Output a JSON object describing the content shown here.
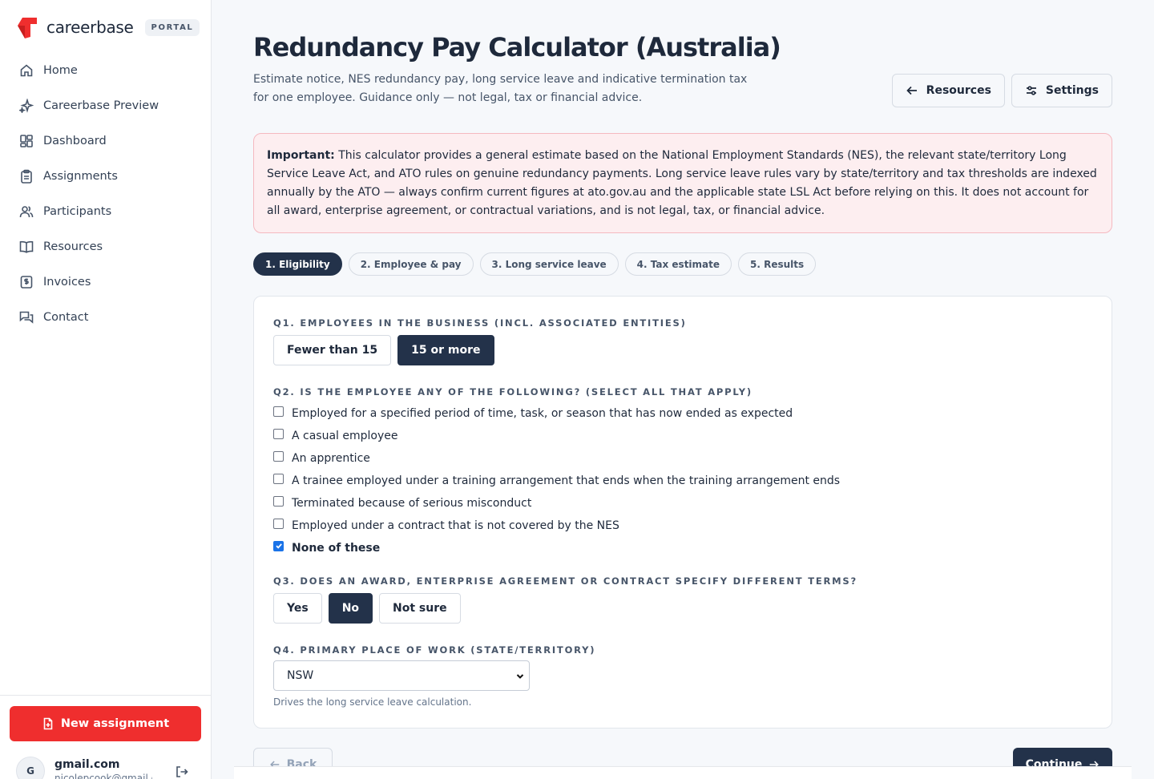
{
  "brand": {
    "name": "careerbase",
    "badge": "PORTAL",
    "accent": "#ef2e2e"
  },
  "sidebar": {
    "items": [
      {
        "label": "Home",
        "icon": "home-icon"
      },
      {
        "label": "Careerbase Preview",
        "icon": "sparkles-icon"
      },
      {
        "label": "Dashboard",
        "icon": "dashboard-icon"
      },
      {
        "label": "Assignments",
        "icon": "clipboard-icon"
      },
      {
        "label": "Participants",
        "icon": "users-icon"
      },
      {
        "label": "Resources",
        "icon": "book-icon"
      },
      {
        "label": "Invoices",
        "icon": "invoice-icon"
      },
      {
        "label": "Contact",
        "icon": "chat-icon"
      }
    ],
    "new_button": "New assignment",
    "user": {
      "initial": "G",
      "name": "gmail.com",
      "email": "nicolepcook@gmail.c"
    }
  },
  "header": {
    "title": "Redundancy Pay Calculator (Australia)",
    "subtitle": "Estimate notice, NES redundancy pay, long service leave and indicative termination tax for one employee. Guidance only — not legal, tax or financial advice.",
    "resources_button": "Resources",
    "settings_button": "Settings"
  },
  "notice": {
    "strong": "Important:",
    "text": " This calculator provides a general estimate based on the National Employment Standards (NES), the relevant state/territory Long Service Leave Act, and ATO rules on genuine redundancy payments. Long service leave rules vary by state/territory and tax thresholds are indexed annually by the ATO — always confirm current figures at ato.gov.au and the applicable state LSL Act before relying on this. It does not account for all award, enterprise agreement, or contractual variations, and is not legal, tax, or financial advice."
  },
  "steps": [
    "1. Eligibility",
    "2. Employee & pay",
    "3. Long service leave",
    "4. Tax estimate",
    "5. Results"
  ],
  "q1": {
    "label": "Q1. EMPLOYEES IN THE BUSINESS (INCL. ASSOCIATED ENTITIES)",
    "options": [
      "Fewer than 15",
      "15 or more"
    ],
    "selected": "15 or more"
  },
  "q2": {
    "label": "Q2. IS THE EMPLOYEE ANY OF THE FOLLOWING? (SELECT ALL THAT APPLY)",
    "options": [
      "Employed for a specified period of time, task, or season that has now ended as expected",
      "A casual employee",
      "An apprentice",
      "A trainee employed under a training arrangement that ends when the training arrangement ends",
      "Terminated because of serious misconduct",
      "Employed under a contract that is not covered by the NES",
      "None of these"
    ],
    "checked": "None of these"
  },
  "q3": {
    "label": "Q3. DOES AN AWARD, ENTERPRISE AGREEMENT OR CONTRACT SPECIFY DIFFERENT TERMS?",
    "options": [
      "Yes",
      "No",
      "Not sure"
    ],
    "selected": "No"
  },
  "q4": {
    "label": "Q4. PRIMARY PLACE OF WORK (STATE/TERRITORY)",
    "value": "NSW",
    "hint": "Drives the long service leave calculation."
  },
  "footer": {
    "back": "Back",
    "continue": "Continue"
  }
}
